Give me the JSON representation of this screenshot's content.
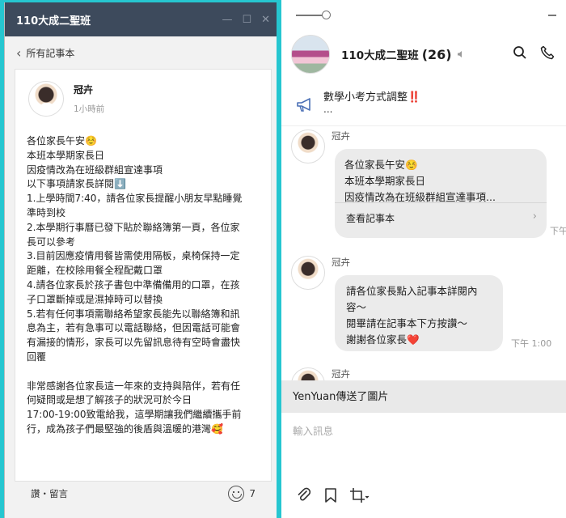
{
  "left_window": {
    "title": "110大成二聖班",
    "back_label": "所有記事本",
    "post": {
      "author": "冠卉",
      "time": "1小時前",
      "lines": [
        "各位家長午安☺️",
        "本班本學期家長日",
        "因疫情改為在班級群組宣達事項",
        "以下事項請家長詳閱⬇️",
        "1.上學時間7:40，請各位家長提醒小朋友早點睡覺",
        "準時到校",
        "2.本學期行事曆已發下貼於聯絡簿第一頁，各位家",
        "長可以參考",
        "3.目前因應疫情用餐皆需使用隔板，桌椅保持一定",
        "距離，在校除用餐全程配戴口罩",
        "4.請各位家長於孩子書包中準備備用的口罩，在孩",
        "子口罩斷掉或是濕掉時可以替換",
        "5.若有任何事項需聯絡希望家長能先以聯絡簿和訊",
        "息為主，若有急事可以電話聯絡，但因電話可能會",
        "有漏接的情形，家長可以先留訊息待有空時會盡快",
        "回覆",
        "",
        "非常感謝各位家長這一年來的支持與陪伴，若有任",
        "何疑問或是想了解孩子的狀況可於今日",
        "17:00-19:00致電給我，這學期讓我們繼續攜手前",
        "行，成為孩子們最堅強的後盾與溫暖的港灣🥰"
      ]
    },
    "footer": {
      "like_comment": "讚・留言",
      "like_count": "7"
    }
  },
  "right_window": {
    "group_name": "110大成二聖班",
    "member_count": "(26)",
    "announcement": {
      "text": "數學小考方式調整‼️",
      "sub": "..."
    },
    "messages": [
      {
        "sender": "冠卉",
        "lines": [
          "各位家長午安☺️",
          "本班本學期家長日",
          "因疫情改為在班級群組宣達事項..."
        ],
        "action": "查看記事本",
        "time": "下午"
      },
      {
        "sender": "冠卉",
        "lines": [
          "請各位家長點入記事本詳閱內",
          "容～",
          "閱畢請在記事本下方按讚～",
          "謝謝各位家長❤️"
        ],
        "time": "下午 1:00"
      },
      {
        "sender": "冠卉"
      }
    ],
    "sent_notice": "YenYuan傳送了圖片",
    "input_placeholder": "輸入訊息"
  },
  "colors": {
    "desktop_bg": "#26c6d0",
    "titlebar_bg": "#3d4a5c",
    "bubble_bg": "#ebebeb"
  }
}
